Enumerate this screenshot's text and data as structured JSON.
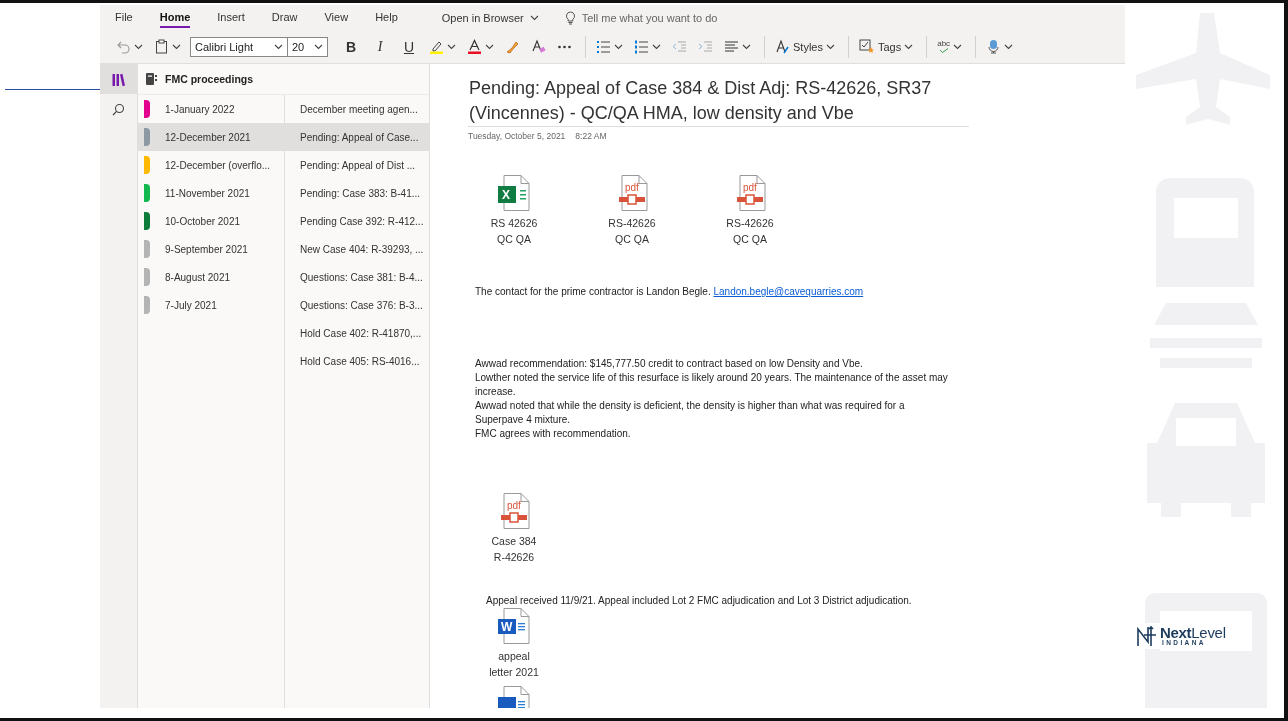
{
  "menu_tabs": [
    {
      "label": "File",
      "selected": false
    },
    {
      "label": "Home",
      "selected": true
    },
    {
      "label": "Insert",
      "selected": false
    },
    {
      "label": "Draw",
      "selected": false
    },
    {
      "label": "View",
      "selected": false
    },
    {
      "label": "Help",
      "selected": false
    }
  ],
  "open_in_browser": "Open in Browser",
  "tell_me": {
    "placeholder": "Tell me what you want to do"
  },
  "toolbar": {
    "font_name": "Calibri Light",
    "font_size": "20",
    "bold": "B",
    "italic": "I",
    "underline": "U",
    "styles": "Styles",
    "tags": "Tags",
    "spelling": "abc"
  },
  "notebook": {
    "title": "FMC proceedings"
  },
  "sections": [
    {
      "label": "1-January 2022",
      "color": "#e3008c",
      "selected": false
    },
    {
      "label": "12-December 2021",
      "color": "#8c98a2",
      "selected": true
    },
    {
      "label": "12-December (overflo...",
      "color": "#ffb900",
      "selected": false
    },
    {
      "label": "11-November 2021",
      "color": "#13b94f",
      "selected": false
    },
    {
      "label": "10-October 2021",
      "color": "#0e7c3a",
      "selected": false
    },
    {
      "label": "9-September 2021",
      "color": "#b4b4b4",
      "selected": false
    },
    {
      "label": "8-August 2021",
      "color": "#b4b4b4",
      "selected": false
    },
    {
      "label": "7-July 2021",
      "color": "#b4b4b4",
      "selected": false
    }
  ],
  "pages": [
    {
      "title": "December meeting agen...",
      "selected": false
    },
    {
      "title": "Pending: Appeal of Case...",
      "selected": true
    },
    {
      "title": "Pending: Appeal of Dist ...",
      "selected": false
    },
    {
      "title": "Pending: Case 383: B-41...",
      "selected": false
    },
    {
      "title": "Pending Case 392: R-412...",
      "selected": false
    },
    {
      "title": "New Case 404: R-39293, ...",
      "selected": false
    },
    {
      "title": "Questions: Case 381: B-4...",
      "selected": false
    },
    {
      "title": "Questions: Case 376: B-3...",
      "selected": false
    },
    {
      "title": "Hold Case 402: R-41870,...",
      "selected": false
    },
    {
      "title": "Hold Case 405: RS-4016...",
      "selected": false
    }
  ],
  "page": {
    "title": "Pending: Appeal of Case 384 & Dist Adj: RS-42626, SR37 (Vincennes) - QC/QA HMA, low density and Vbe",
    "date": "Tuesday, October 5, 2021",
    "time": "8:22 AM",
    "blocks": [
      {
        "kind": "attachments",
        "items": [
          {
            "kind": "excel",
            "icon_text": "X",
            "lines": [
              "RS 42626",
              "QC QA"
            ]
          },
          {
            "kind": "pdf",
            "icon_text": "pdf",
            "lines": [
              "RS-42626",
              "QC QA"
            ]
          },
          {
            "kind": "pdf",
            "icon_text": "pdf",
            "lines": [
              "RS-42626",
              "QC QA"
            ]
          }
        ]
      },
      {
        "kind": "contact",
        "text": "The contact for the prime contractor is Landon Begle.",
        "link": "Landon.begle@cavequarries.com"
      },
      {
        "kind": "notes",
        "lines": [
          "Awwad recommendation: $145,777.50 credit to contract based on low Density and Vbe.",
          "Lowther noted the service life of this resurface is likely around 20 years. The maintenance of the asset may increase.",
          "Awwad noted that while the density is deficient, the density is higher than what was required for a Superpave 4 mixture.",
          "FMC agrees with recommendation."
        ]
      },
      {
        "kind": "attachments",
        "items": [
          {
            "kind": "pdf",
            "icon_text": "pdf",
            "lines": [
              "Case 384",
              "R-42626"
            ]
          }
        ]
      },
      {
        "kind": "paragraph",
        "text": "Appeal received 11/9/21. Appeal included Lot 2 FMC adjudication and Lot 3 District adjudication."
      },
      {
        "kind": "attachments",
        "items": [
          {
            "kind": "word",
            "icon_text": "W",
            "lines": [
              "appeal",
              "letter 2021"
            ]
          }
        ]
      },
      {
        "kind": "attachments",
        "items": [
          {
            "kind": "word"
          }
        ]
      }
    ]
  },
  "logo": {
    "name": "**Next**Level",
    "tagline": "INDIANA"
  }
}
